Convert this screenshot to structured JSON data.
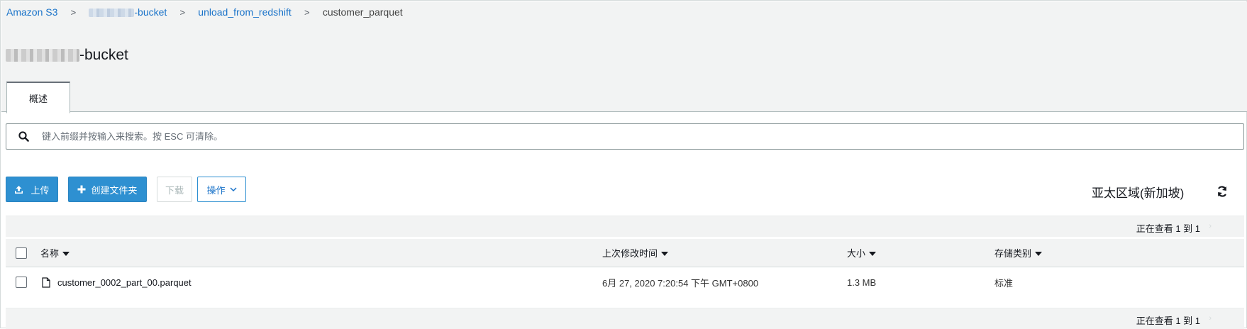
{
  "breadcrumb": {
    "root": "Amazon S3",
    "bucket_suffix": "-bucket",
    "folder": "unload_from_redshift",
    "current": "customer_parquet",
    "separator": ">"
  },
  "page": {
    "title_suffix": "-bucket"
  },
  "tabs": [
    {
      "label": "概述",
      "active": true
    }
  ],
  "search": {
    "placeholder": "键入前缀并按输入来搜索。按 ESC 可清除。",
    "value": ""
  },
  "toolbar": {
    "upload_label": "上传",
    "create_folder_label": "创建文件夹",
    "download_label": "下载",
    "actions_label": "操作"
  },
  "region": "亚太区域(新加坡)",
  "pager": {
    "top_text": "正在查看 1 到 1",
    "bottom_text": "正在查看 1 到 1"
  },
  "table": {
    "columns": [
      "名称",
      "上次修改时间",
      "大小",
      "存储类别"
    ],
    "rows": [
      {
        "name": "customer_0002_part_00.parquet",
        "modified": "6月 27, 2020 7:20:54 下午 GMT+0800",
        "size": "1.3 MB",
        "storage_class": "标准"
      }
    ]
  },
  "colors": {
    "accent": "#2e90d1",
    "link": "#1a73c9",
    "header_bg": "#f2f3f3"
  },
  "icons": [
    "upload-icon",
    "plus-icon",
    "chevron-down-icon",
    "search-icon",
    "refresh-icon",
    "file-icon",
    "caret-down-icon"
  ]
}
